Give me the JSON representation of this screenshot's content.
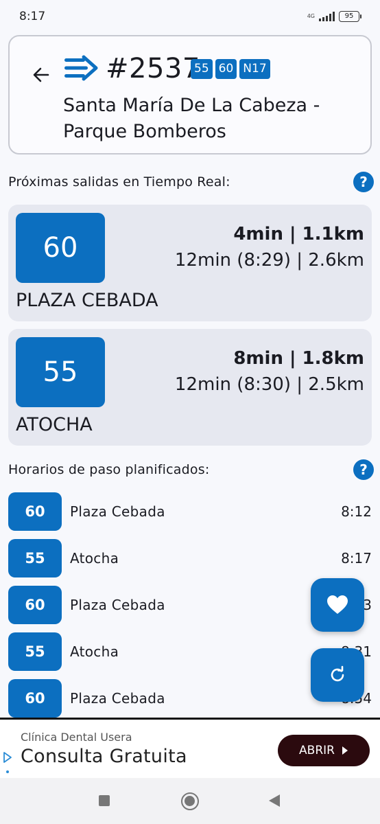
{
  "status_bar": {
    "time": "8:17",
    "network": "4G",
    "battery": "95"
  },
  "header": {
    "stop_number": "#2537",
    "separator": "·",
    "lines": [
      "55",
      "60",
      "N17"
    ],
    "stop_name": "Santa María De La Cabeza - Parque Bomberos",
    "back_icon": "arrow-left-icon",
    "logo_icon": "transit-logo-icon"
  },
  "realtime": {
    "title": "Próximas salidas en Tiempo Real:",
    "help": "?",
    "cards": [
      {
        "line": "60",
        "destination": "PLAZA CEBADA",
        "primary": "4min | 1.1km",
        "secondary": "12min (8:29) | 2.6km"
      },
      {
        "line": "55",
        "destination": "ATOCHA",
        "primary": "8min | 1.8km",
        "secondary": "12min (8:30) | 2.5km"
      }
    ]
  },
  "schedule": {
    "title": "Horarios de paso planificados:",
    "help": "?",
    "rows": [
      {
        "line": "60",
        "destination": "Plaza Cebada",
        "time": "8:12"
      },
      {
        "line": "55",
        "destination": "Atocha",
        "time": "8:17"
      },
      {
        "line": "60",
        "destination": "Plaza Cebada",
        "time": "3"
      },
      {
        "line": "55",
        "destination": "Atocha",
        "time": "8:31"
      },
      {
        "line": "60",
        "destination": "Plaza Cebada",
        "time": "8:54"
      }
    ]
  },
  "fabs": {
    "favorite_icon": "heart-icon",
    "refresh_icon": "refresh-icon"
  },
  "ad": {
    "advertiser": "Clínica Dental Usera",
    "headline": "Consulta Gratuita",
    "cta": "ABRIR"
  },
  "colors": {
    "primary": "#0c6fc0",
    "card_bg": "#e6e8f0",
    "background": "#f7f8fc",
    "ad_button": "#2b0a0e"
  }
}
